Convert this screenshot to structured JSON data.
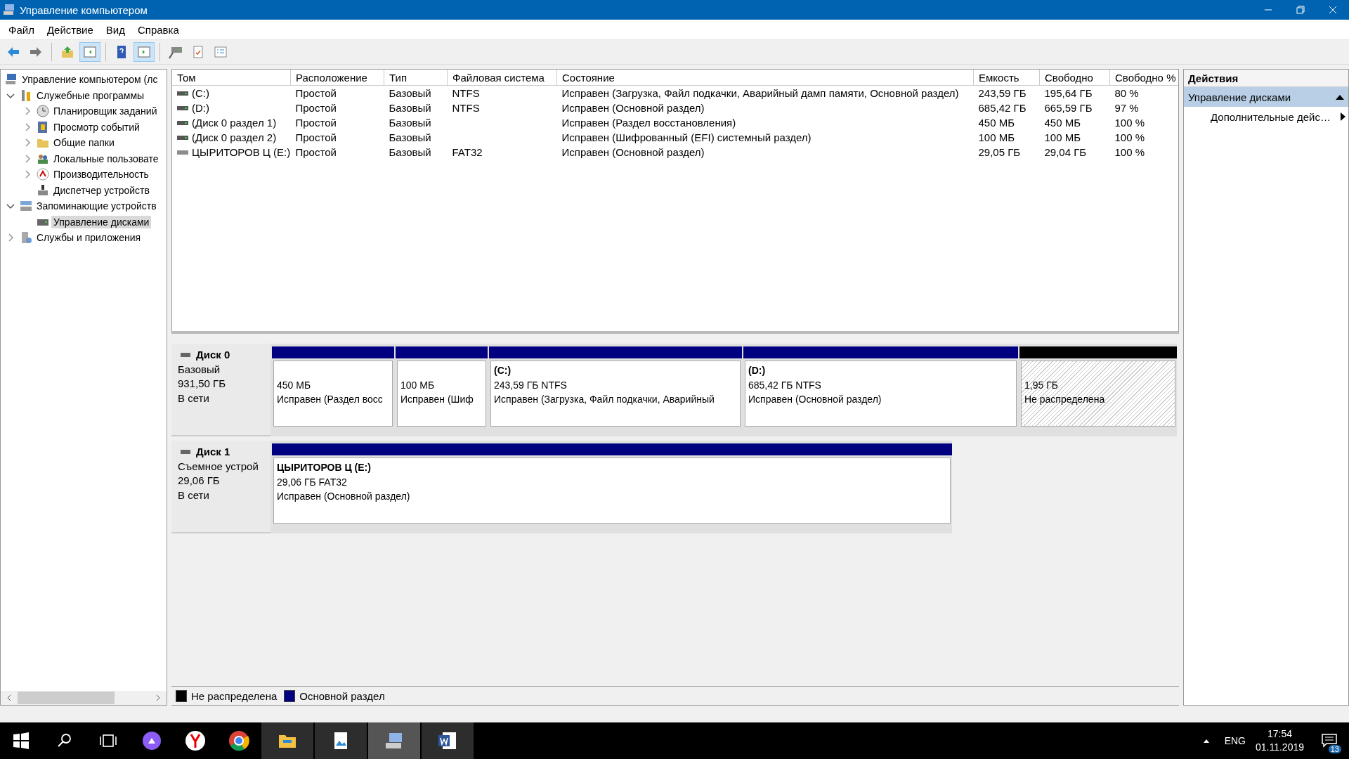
{
  "window": {
    "title": "Управление компьютером"
  },
  "menu": [
    "Файл",
    "Действие",
    "Вид",
    "Справка"
  ],
  "toolbar": [
    {
      "kind": "back",
      "on": false
    },
    {
      "kind": "forward",
      "on": false
    },
    {
      "kind": "up",
      "on": false
    },
    {
      "kind": "tree",
      "on": true
    },
    {
      "kind": "help",
      "on": false
    },
    {
      "kind": "actions",
      "on": true
    },
    {
      "kind": "connect",
      "on": false
    },
    {
      "kind": "properties",
      "on": false
    },
    {
      "kind": "list",
      "on": false
    }
  ],
  "tree": {
    "items": [
      {
        "label": "Управление компьютером (лс",
        "kind": "computer",
        "selected": false,
        "children": [
          {
            "label": "Служебные программы",
            "kind": "tools",
            "expanded": true,
            "selected": false,
            "children": [
              {
                "label": "Планировщик заданий",
                "kind": "clock",
                "expanded": false,
                "selected": false
              },
              {
                "label": "Просмотр событий",
                "kind": "log",
                "expanded": false,
                "selected": false
              },
              {
                "label": "Общие папки",
                "kind": "folder",
                "expanded": false,
                "selected": false
              },
              {
                "label": "Локальные пользовате",
                "kind": "users",
                "expanded": false,
                "selected": false
              },
              {
                "label": "Производительность",
                "kind": "perf",
                "expanded": false,
                "selected": false
              },
              {
                "label": "Диспетчер устройств",
                "kind": "device",
                "selected": false
              }
            ]
          },
          {
            "label": "Запоминающие устройств",
            "kind": "storage",
            "expanded": true,
            "selected": false,
            "children": [
              {
                "label": "Управление дисками",
                "kind": "disk",
                "selected": true
              }
            ]
          },
          {
            "label": "Службы и приложения",
            "kind": "services",
            "expanded": false,
            "selected": false
          }
        ]
      }
    ]
  },
  "table": {
    "columns": [
      "Том",
      "Расположение",
      "Тип",
      "Файловая система",
      "Состояние",
      "Емкость",
      "Свободно",
      "Свободно %"
    ],
    "rows": [
      {
        "kind": "fixed",
        "cells": [
          "(C:)",
          "Простой",
          "Базовый",
          "NTFS",
          "Исправен (Загрузка, Файл подкачки, Аварийный дамп памяти, Основной раздел)",
          "243,59 ГБ",
          "195,64 ГБ",
          "80 %"
        ]
      },
      {
        "kind": "fixed",
        "cells": [
          "(D:)",
          "Простой",
          "Базовый",
          "NTFS",
          "Исправен (Основной раздел)",
          "685,42 ГБ",
          "665,59 ГБ",
          "97 %"
        ]
      },
      {
        "kind": "fixed",
        "cells": [
          "(Диск 0 раздел 1)",
          "Простой",
          "Базовый",
          "",
          "Исправен (Раздел восстановления)",
          "450 МБ",
          "450 МБ",
          "100 %"
        ]
      },
      {
        "kind": "fixed",
        "cells": [
          "(Диск 0 раздел 2)",
          "Простой",
          "Базовый",
          "",
          "Исправен (Шифрованный (EFI) системный раздел)",
          "100 МБ",
          "100 МБ",
          "100 %"
        ]
      },
      {
        "kind": "removable",
        "cells": [
          "ЦЫРИТОРОВ Ц (E:)",
          "Простой",
          "Базовый",
          "FAT32",
          "Исправен (Основной раздел)",
          "29,05 ГБ",
          "29,04 ГБ",
          "100 %"
        ]
      }
    ]
  },
  "disks": [
    {
      "name": "Диск 0",
      "type": "Базовый",
      "size": "931,50 ГБ",
      "status": "В сети",
      "partitions": [
        {
          "kind": "primary",
          "size": "450 МБ",
          "status": "Исправен (Раздел восс"
        },
        {
          "kind": "primary",
          "size": "100 МБ",
          "status": "Исправен (Шиф"
        },
        {
          "kind": "primary",
          "name": "(C:)",
          "size": "243,59 ГБ NTFS",
          "status": "Исправен (Загрузка, Файл подкачки, Аварийный"
        },
        {
          "kind": "primary",
          "name": "(D:)",
          "size": "685,42 ГБ NTFS",
          "status": "Исправен (Основной раздел)"
        },
        {
          "kind": "unallocated",
          "size": "1,95 ГБ",
          "status": "Не распределена"
        }
      ]
    },
    {
      "name": "Диск 1",
      "type": "Съемное устрой",
      "size": "29,06 ГБ",
      "status": "В сети",
      "partitions": [
        {
          "kind": "primary",
          "name": "ЦЫРИТОРОВ Ц (E:)",
          "size": "29,06 ГБ FAT32",
          "status": "Исправен (Основной раздел)"
        }
      ]
    }
  ],
  "legend": [
    {
      "label": "Не распределена",
      "color": "#000000"
    },
    {
      "label": "Основной раздел",
      "color": "#000080"
    }
  ],
  "actions": {
    "title": "Действия",
    "sections": [
      {
        "label": "Управление дисками",
        "expanded": true,
        "items": [
          "Дополнительные дейс…"
        ]
      }
    ]
  },
  "taskbar": {
    "buttons": [
      {
        "kind": "start",
        "running": false,
        "selected": false
      },
      {
        "kind": "search",
        "running": false,
        "selected": false
      },
      {
        "kind": "taskview",
        "running": false,
        "selected": false
      },
      {
        "kind": "assistant",
        "running": false,
        "selected": false
      },
      {
        "kind": "browser-y",
        "running": false,
        "selected": false
      },
      {
        "kind": "browser-c",
        "running": false,
        "selected": false
      },
      {
        "kind": "explorer",
        "running": true,
        "selected": false
      },
      {
        "kind": "photos",
        "running": true,
        "selected": false
      },
      {
        "kind": "mmc",
        "running": true,
        "selected": true
      },
      {
        "kind": "word",
        "running": true,
        "selected": false
      }
    ],
    "language": "ENG",
    "time": "17:54",
    "date": "01.11.2019",
    "notifications": "13"
  }
}
